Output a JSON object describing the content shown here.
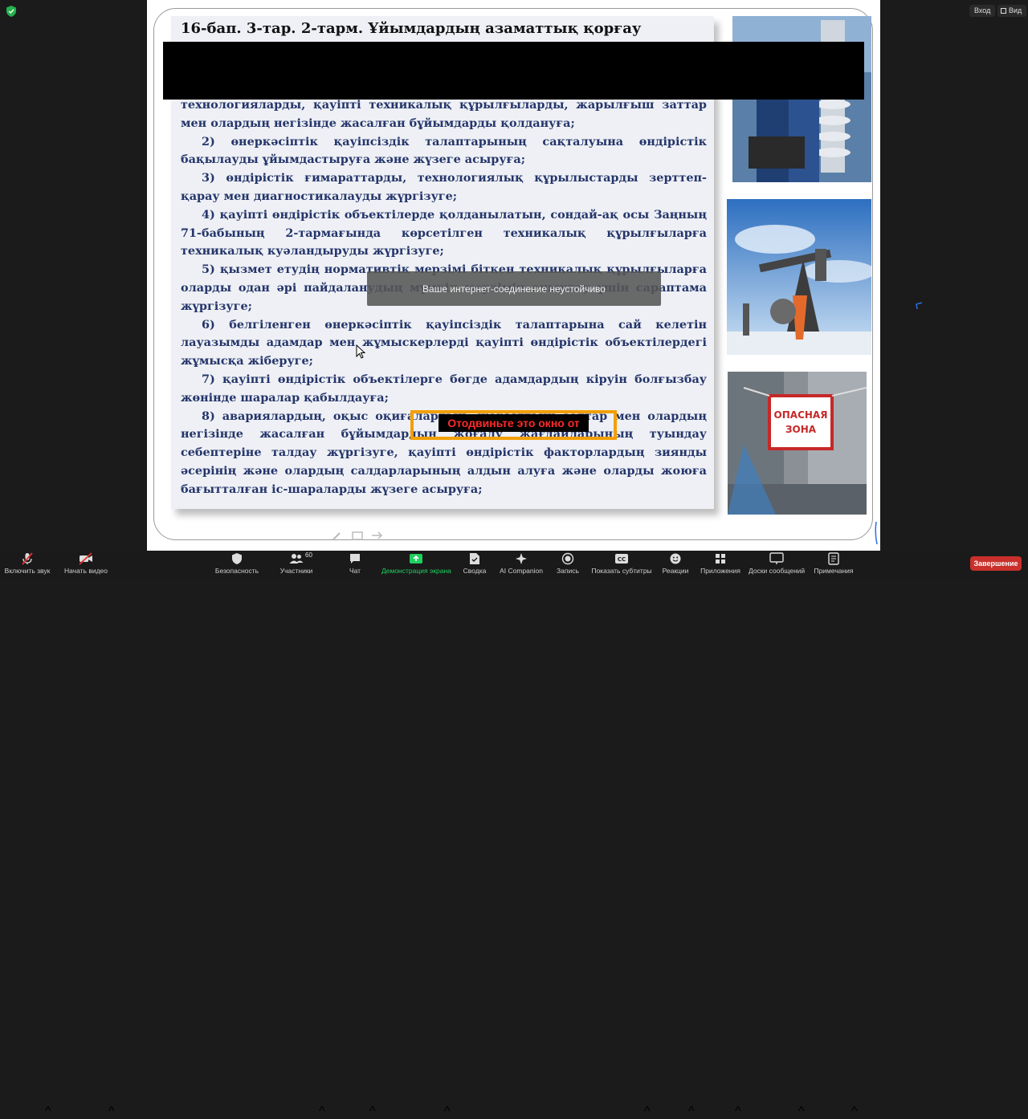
{
  "top_bar": {
    "login_label": "Вход",
    "view_label": "Вид"
  },
  "slide": {
    "title": "16-бап. 3-тар. 2-тарм. Ұйымдардың азаматтық қорғау",
    "paragraphs": [
      {
        "text": "технологияларды, қауіпті техникалық құрылғыларды, жарылғыш заттар мен олардың негізінде жасалған бұйымдарды қолдануға;",
        "indent": false
      },
      {
        "text": "2) өнеркәсіптік қауіпсіздік талаптарының сақталуына өндірістік бақылауды ұйымдастыруға және жүзеге асыруға;",
        "indent": true
      },
      {
        "text": "3) өндірістік ғимараттарды, технологиялық құрылыстарды зерттеп-қарау мен диагностикалауды жүргізуге;",
        "indent": true
      },
      {
        "text": "4) қауіпті өндірістік объектілерде қолданылатын, сондай-ақ осы Заңның 71-бабының 2-тармағында көрсетілген техникалық құрылғыларға техникалық куәландыруды жүргізуге;",
        "indent": true
      },
      {
        "text": "5) қызмет етудің нормативтік мерзімі біткен техникалық құрылғыларға оларды одан әрі пайдаланудың мүмкін мерзімін анықтау үшін сараптама жүргізуге;",
        "indent": true
      },
      {
        "text": "6) белгіленген өнеркәсіптік қауіпсіздік талаптарына сай келетін лауазымды адамдар мен жұмыскерлерді қауіпті өндірістік объектілердегі жұмысқа жіберуге;",
        "indent": true
      },
      {
        "text": "7) қауіпті өндірістік объектілерге бөгде адамдардың кіруін болғызбау жөнінде шаралар қабылдауға;",
        "indent": true
      },
      {
        "text": "8) авариялардың, оқыс оқиғалардың, жарылғыш заттар мен олардың негізінде жасалған бұйымдардың жоғалу жағдайларының туындау себептеріне талдау жүргізуге, қауіпті өндірістік факторлардың зиянды әсерінің және олардың салдарларының алдын алуға және оларды жоюға бағытталған іс-шараларды жүзеге асыруға;",
        "indent": true
      }
    ],
    "photo_sign_line1": "ОПАСНАЯ",
    "photo_sign_line2": "ЗОНА"
  },
  "overlays": {
    "connection_warning": "Ваше интернет-соединение неустойчиво",
    "move_window_warning": "Отодвиньте это окно от"
  },
  "toolbar": {
    "items": [
      {
        "label": "Включить звук",
        "icon": "mic-muted-icon"
      },
      {
        "label": "Начать видео",
        "icon": "video-off-icon"
      },
      {
        "label": "Безопасность",
        "icon": "shield-icon"
      },
      {
        "label": "Участники",
        "icon": "participants-icon",
        "count": "60"
      },
      {
        "label": "Чат",
        "icon": "chat-icon"
      },
      {
        "label": "Демонстрация экрана",
        "icon": "share-screen-icon"
      },
      {
        "label": "Сводка",
        "icon": "summary-icon"
      },
      {
        "label": "AI Companion",
        "icon": "ai-companion-icon"
      },
      {
        "label": "Запись",
        "icon": "record-icon"
      },
      {
        "label": "Показать субтитры",
        "icon": "captions-icon"
      },
      {
        "label": "Реакции",
        "icon": "reactions-icon"
      },
      {
        "label": "Приложения",
        "icon": "apps-icon"
      },
      {
        "label": "Доски сообщений",
        "icon": "whiteboards-icon"
      },
      {
        "label": "Примечания",
        "icon": "notes-icon"
      }
    ],
    "end_label": "Завершение"
  },
  "colors": {
    "slide_text": "#24356a",
    "share_accent": "#1fcf5f",
    "end_button": "#c9302c",
    "warning_border": "#f29f05",
    "warning_text": "#ff2a2a"
  }
}
